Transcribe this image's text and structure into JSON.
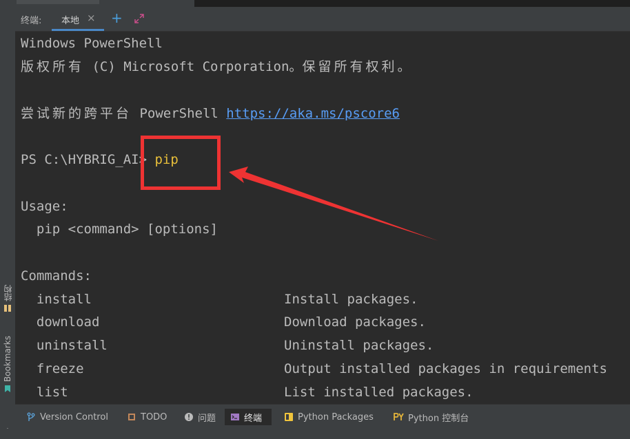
{
  "tool_window": {
    "title": "终端:",
    "tab_label": "本地",
    "tab_close": "×",
    "new_tab": "+"
  },
  "left_stripe": {
    "structure_label": "结构",
    "bookmarks_label": "Bookmarks"
  },
  "terminal": {
    "line1": "Windows PowerShell",
    "line2_cjk": "版权所有",
    "line2_rest": " (C) Microsoft Corporation。",
    "line2_cjk2": "保留所有权利。",
    "line3_cjk": "尝试新的跨平台",
    "line3_text": " PowerShell ",
    "line3_link": "https://aka.ms/pscore6",
    "prompt": "PS C:\\HYBRIG_AI> ",
    "command": "pip",
    "usage_header": "Usage:",
    "usage_line": "  pip <command> [options]",
    "commands_header": "Commands:",
    "commands": [
      {
        "name": "  install",
        "desc": "Install packages."
      },
      {
        "name": "  download",
        "desc": "Download packages."
      },
      {
        "name": "  uninstall",
        "desc": "Uninstall packages."
      },
      {
        "name": "  freeze",
        "desc": "Output installed packages in requirements"
      },
      {
        "name": "  list",
        "desc": "List installed packages."
      }
    ]
  },
  "bottom_bar": {
    "items": [
      {
        "label": "Version Control"
      },
      {
        "label": "TODO"
      },
      {
        "label": "问题"
      },
      {
        "label": "终端"
      },
      {
        "label": "Python Packages"
      },
      {
        "label": "Python 控制台"
      }
    ]
  },
  "colors": {
    "background": "#2b2b2b",
    "panel": "#3c3f41",
    "text": "#bbbbbb",
    "link": "#589df6",
    "command": "#e8bf3a",
    "annotation": "#ee3333",
    "tab_underline": "#4a88c7"
  }
}
